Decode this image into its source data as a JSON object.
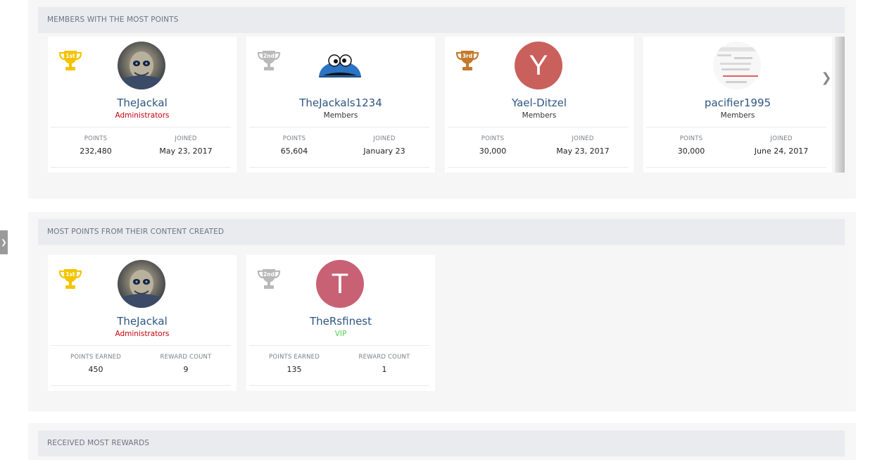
{
  "sections": [
    {
      "title": "MEMBERS WITH THE MOST POINTS",
      "cards": [
        {
          "rank": "1st",
          "trophy_color": "#f4c400",
          "username": "TheJackal",
          "usertitle": "Administrators",
          "stat1_label": "POINTS",
          "stat1_value": "232,480",
          "stat2_label": "JOINED",
          "stat2_value": "May 23, 2017"
        },
        {
          "rank": "2nd",
          "trophy_color": "#b9b9b9",
          "username": "TheJackals1234",
          "usertitle": "Members",
          "stat1_label": "POINTS",
          "stat1_value": "65,604",
          "stat2_label": "JOINED",
          "stat2_value": "January 23"
        },
        {
          "rank": "3rd",
          "trophy_color": "#c47a2c",
          "username": "Yael-Ditzel",
          "usertitle": "Members",
          "avatar_letter": "Y",
          "avatar_color": "#c9605c",
          "stat1_label": "POINTS",
          "stat1_value": "30,000",
          "stat2_label": "JOINED",
          "stat2_value": "May 23, 2017"
        },
        {
          "username": "pacifier1995",
          "usertitle": "Members",
          "stat1_label": "POINTS",
          "stat1_value": "30,000",
          "stat2_label": "JOINED",
          "stat2_value": "June 24, 2017"
        }
      ]
    },
    {
      "title": "MOST POINTS FROM THEIR CONTENT CREATED",
      "cards": [
        {
          "rank": "1st",
          "trophy_color": "#f4c400",
          "username": "TheJackal",
          "usertitle": "Administrators",
          "stat1_label": "POINTS EARNED",
          "stat1_value": "450",
          "stat2_label": "REWARD COUNT",
          "stat2_value": "9"
        },
        {
          "rank": "2nd",
          "trophy_color": "#b9b9b9",
          "username": "TheRsfinest",
          "usertitle": "VIP",
          "avatar_letter": "T",
          "avatar_color": "#c96174",
          "stat1_label": "POINTS EARNED",
          "stat1_value": "135",
          "stat2_label": "REWARD COUNT",
          "stat2_value": "1"
        }
      ]
    },
    {
      "title": "RECEIVED MOST REWARDS"
    }
  ],
  "icons": {
    "trophy": "trophy-icon",
    "carousel_next": "chevron-right-icon",
    "side_tab": "chevron-right-icon"
  },
  "colors": {
    "admin": "#c6000b",
    "vip": "#4fd24f",
    "username": "#2e5583"
  }
}
